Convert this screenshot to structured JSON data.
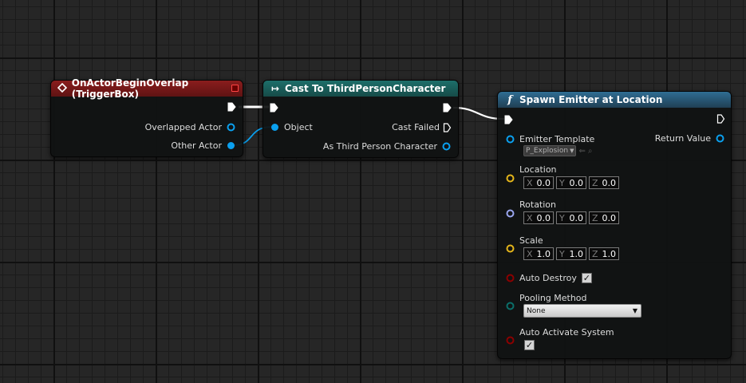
{
  "event_node": {
    "title": "OnActorBeginOverlap (TriggerBox)",
    "header_color": "#7a1919",
    "pins": {
      "overlapped_actor": "Overlapped Actor",
      "other_actor": "Other Actor"
    }
  },
  "cast_node": {
    "title": "Cast To ThirdPersonCharacter",
    "header_color": "#1b5e5a",
    "pins": {
      "object": "Object",
      "cast_failed": "Cast Failed",
      "as_third_person_character": "As Third Person Character"
    }
  },
  "spawn_node": {
    "title": "Spawn Emitter at Location",
    "header_color": "#2a5874",
    "pins": {
      "emitter_template": "Emitter Template",
      "emitter_template_value": "P_Explosion",
      "return_value": "Return Value",
      "location": "Location",
      "location_values": {
        "x": "0.0",
        "y": "0.0",
        "z": "0.0"
      },
      "rotation": "Rotation",
      "rotation_values": {
        "x": "0.0",
        "y": "0.0",
        "z": "0.0"
      },
      "scale": "Scale",
      "scale_values": {
        "x": "1.0",
        "y": "1.0",
        "z": "1.0"
      },
      "auto_destroy": "Auto Destroy",
      "auto_destroy_checked": true,
      "pooling_method": "Pooling Method",
      "pooling_method_value": "None",
      "auto_activate_system": "Auto Activate System",
      "auto_activate_checked": true
    }
  },
  "axis_labels": {
    "x": "X",
    "y": "Y",
    "z": "Z"
  },
  "pin_colors": {
    "object": "#0aa0ef",
    "vector": "#e4b51a",
    "rotator": "#9aa6ef",
    "bool": "#8c0000",
    "enum": "#0b6f6a",
    "exec": "#ffffff"
  }
}
